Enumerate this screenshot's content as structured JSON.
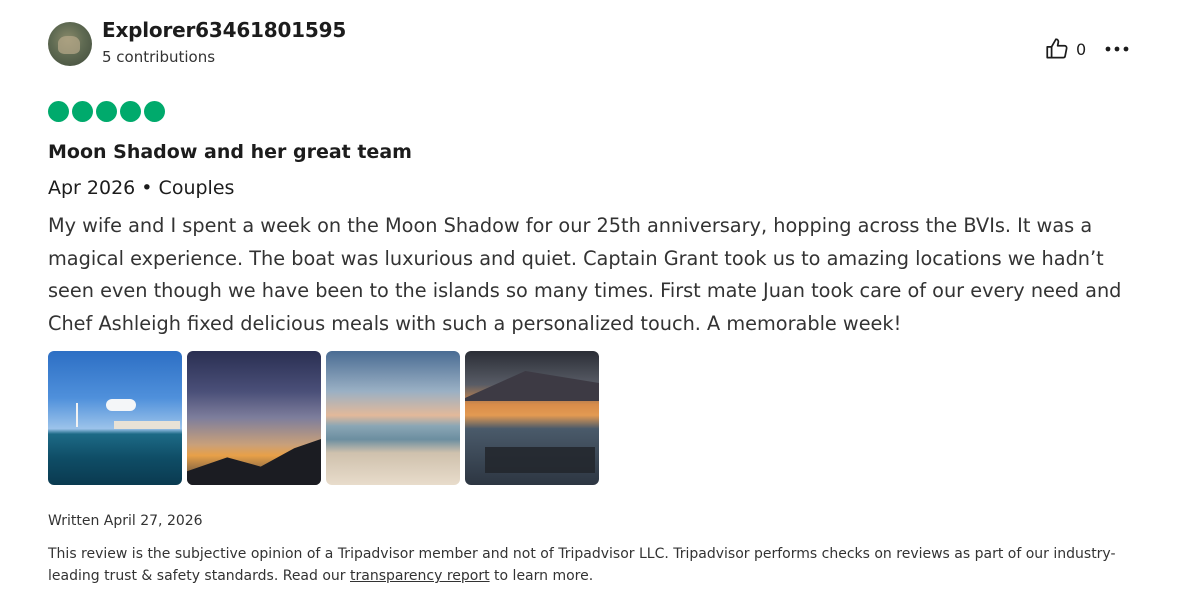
{
  "reviewer": {
    "name": "Explorer63461801595",
    "contributions": "5 contributions"
  },
  "actions": {
    "helpful_count": "0",
    "helpful_icon": "thumbs-up-icon",
    "more_icon": "more-options-icon"
  },
  "review": {
    "rating": 5,
    "rating_color": "#00aa6c",
    "title": "Moon Shadow and her great team",
    "meta": "Apr 2026 • Couples",
    "body": "My wife and I spent a week on the Moon Shadow for our 25th anniversary, hopping across the BVIs. It was a magical experience. The boat was luxurious and quiet. Captain Grant took us to amazing locations we hadn’t seen even though we have been to the islands so many times. First mate Juan took care of our every need and Chef Ashleigh fixed delicious meals with such a personalized touch. A memorable week!",
    "written": "Written April 27, 2026"
  },
  "disclaimer": {
    "text_before": "This review is the subjective opinion of a Tripadvisor member and not of Tripadvisor LLC. Tripadvisor performs checks on reviews as part of our industry-leading trust & safety standards. Read our ",
    "link": "transparency report",
    "text_after": " to learn more."
  }
}
